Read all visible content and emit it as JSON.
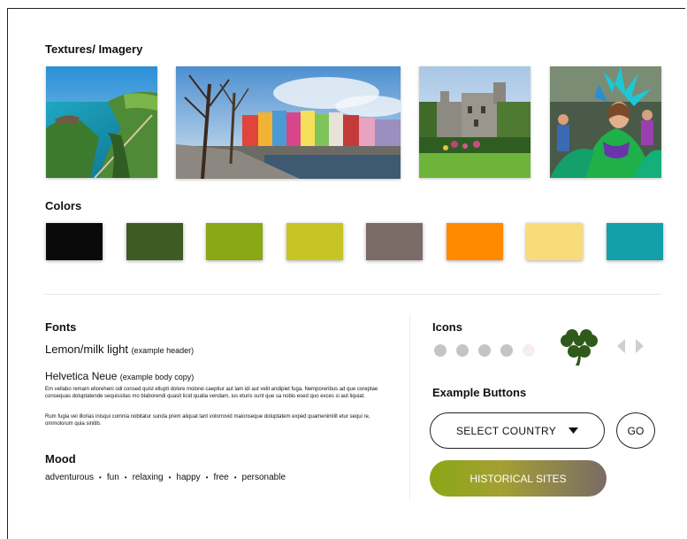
{
  "sections": {
    "textures": "Textures/ Imagery",
    "colors": "Colors",
    "fonts": "Fonts",
    "icons": "Icons",
    "buttons": "Example Buttons",
    "mood": "Mood"
  },
  "fonts": {
    "header_name": "Lemon/milk light",
    "header_note": "(example header)",
    "body_name": "Helvetica Neue",
    "body_note": "(example body copy)",
    "para1": "Em vellabo remam elloreheni odi consed quist ellupti dolore molorei caeptiur aut lam idi aut velit andipiet fuga. Nemporeribus ad que coreptae consequas doluptatende sequissitas mo blaborendi quasit licid quatia vendam, ius eturis sunt que sa nobis esed quo exces si aut liquiat.",
    "para2": "Rum fugia vel illorias inisqui comnia nobitatur sunda prem aliquat lant volorrovid maionseque doluptatem exped quamenimilit etur sequi re, ommolorum quia sinitib."
  },
  "mood": [
    "adventurous",
    "fun",
    "relaxing",
    "happy",
    "free",
    "personable"
  ],
  "mood_separator": "•",
  "colors": [
    "#0a0a0a",
    "#3f5a24",
    "#8aa714",
    "#c7c526",
    "#7a6b66",
    "#ff8a00",
    "#f9dc7a",
    "#14a0a8"
  ],
  "icons": {
    "dot_colors": [
      "#c4c4c4",
      "#c4c4c4",
      "#c4c4c4",
      "#c4c4c4",
      "#f7edf0"
    ],
    "shamrock_color": "#2e5a1a",
    "arrow_color": "#cfcfcf"
  },
  "buttons": {
    "select_label": "SELECT COUNTRY",
    "go_label": "GO",
    "historical_label": "HISTORICAL SITES"
  }
}
